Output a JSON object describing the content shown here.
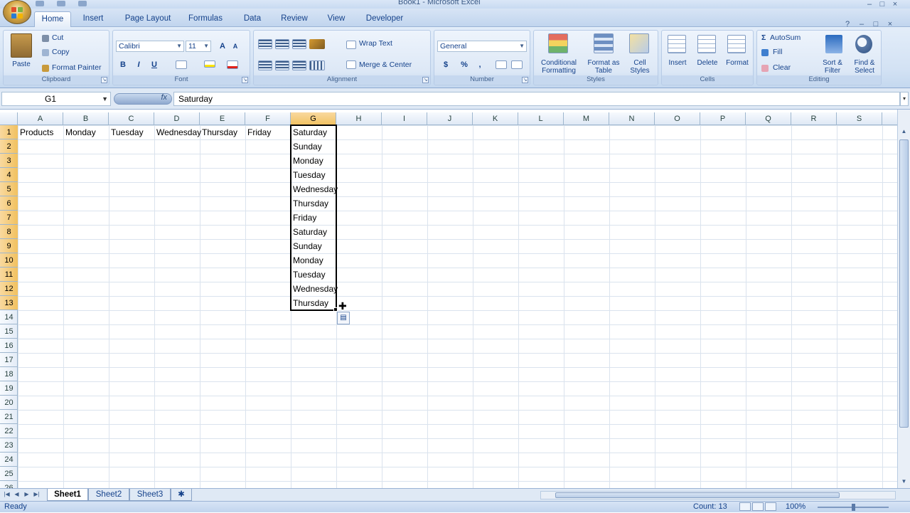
{
  "window": {
    "title": "Book1 - Microsoft Excel",
    "controls": [
      "–",
      "□",
      "×"
    ]
  },
  "ribbon_tabs": [
    "Home",
    "Insert",
    "Page Layout",
    "Formulas",
    "Data",
    "Review",
    "View",
    "Developer"
  ],
  "ribbon_right_controls": [
    "?",
    "–",
    "□",
    "×"
  ],
  "groups": {
    "clipboard": {
      "label": "Clipboard",
      "paste": "Paste",
      "cut": "Cut",
      "copy": "Copy",
      "format_painter": "Format Painter"
    },
    "font": {
      "label": "Font",
      "name": "Calibri",
      "size": "11",
      "bold": "B",
      "italic": "I",
      "underline": "U",
      "grow": "A",
      "shrink": "A"
    },
    "alignment": {
      "label": "Alignment",
      "wrap_text": "Wrap Text",
      "merge_center": "Merge & Center"
    },
    "number": {
      "label": "Number",
      "format": "General",
      "currency": "$",
      "percent": "%",
      "comma": ","
    },
    "styles": {
      "label": "Styles",
      "conditional_formatting": "Conditional Formatting",
      "format_as_table": "Format as Table",
      "cell_styles": "Cell Styles"
    },
    "cells": {
      "label": "Cells",
      "insert": "Insert",
      "delete": "Delete",
      "format": "Format"
    },
    "editing": {
      "label": "Editing",
      "autosum": "AutoSum",
      "fill": "Fill",
      "clear": "Clear",
      "sort_filter": "Sort & Filter",
      "find_select": "Find & Select"
    }
  },
  "formula_bar": {
    "name_box": "G1",
    "fx": "fx",
    "value": "Saturday"
  },
  "columns": [
    "A",
    "B",
    "C",
    "D",
    "E",
    "F",
    "G",
    "H",
    "I",
    "J",
    "K",
    "L",
    "M",
    "N",
    "O",
    "P",
    "Q",
    "R",
    "S"
  ],
  "rows": [
    "1",
    "2",
    "3",
    "4",
    "5",
    "6",
    "7",
    "8",
    "9",
    "10",
    "11",
    "12",
    "13",
    "14",
    "15",
    "16",
    "17",
    "18",
    "19",
    "20",
    "21",
    "22",
    "23",
    "24",
    "25",
    "26"
  ],
  "cells": {
    "A1": "Products",
    "B1": "Monday",
    "C1": "Tuesday",
    "D1": "Wednesday",
    "E1": "Thursday",
    "F1": "Friday",
    "G1": "Saturday",
    "G2": "Sunday",
    "G3": "Monday",
    "G4": "Tuesday",
    "G5": "Wednesday",
    "G6": "Thursday",
    "G7": "Friday",
    "G8": "Saturday",
    "G9": "Sunday",
    "G10": "Monday",
    "G11": "Tuesday",
    "G12": "Wednesday",
    "G13": "Thursday"
  },
  "selection": {
    "active_cell": "G1",
    "range": "G1:G13"
  },
  "sheets": [
    "Sheet1",
    "Sheet2",
    "Sheet3"
  ],
  "active_sheet": "Sheet1",
  "status": {
    "mode": "Ready",
    "count": "Count: 13",
    "zoom": "100%"
  },
  "colors": {
    "accent": "#15428b",
    "selection_header": "#f1c15f",
    "grid": "#dae3ee"
  }
}
